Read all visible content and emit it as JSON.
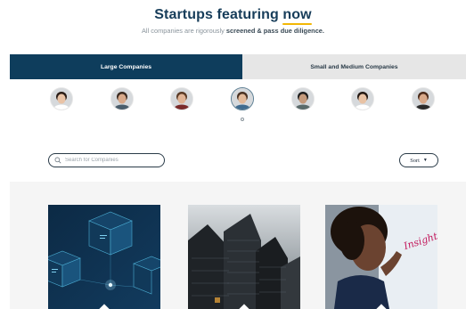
{
  "header": {
    "title_prefix": "Startups featuring ",
    "title_highlight": "now",
    "subtitle_prefix": "All companies are rigorously ",
    "subtitle_bold": "screened & pass due diligence."
  },
  "tabs": [
    {
      "label": "Large Companies",
      "active": true
    },
    {
      "label": "Small and Medium Companies",
      "active": false
    }
  ],
  "avatars": [
    {
      "name": "founder-avatar-1",
      "skin": "#e9c3a6",
      "hair": "#2b1d16",
      "shirt": "#ffffff"
    },
    {
      "name": "founder-avatar-2",
      "skin": "#d8a98a",
      "hair": "#3b2a20",
      "shirt": "#4a5d6b"
    },
    {
      "name": "founder-avatar-3",
      "skin": "#e0b496",
      "hair": "#5a3a25",
      "shirt": "#7a2a2a"
    },
    {
      "name": "founder-avatar-4",
      "skin": "#e2b999",
      "hair": "#4a3122",
      "shirt": "#3f6b8f"
    },
    {
      "name": "founder-avatar-5",
      "skin": "#c49a7c",
      "hair": "#1e1e1e",
      "shirt": "#5a6a6a"
    },
    {
      "name": "founder-avatar-6",
      "skin": "#e8c2a4",
      "hair": "#231812",
      "shirt": "#ffffff"
    },
    {
      "name": "founder-avatar-7",
      "skin": "#d8a98a",
      "hair": "#4a2a1a",
      "shirt": "#2a2a2a"
    }
  ],
  "search": {
    "placeholder": "Search for Companies",
    "value": ""
  },
  "sort": {
    "label": "Sort",
    "caret": "▼"
  },
  "cards": [
    {
      "name": "blockchain-cubes-image"
    },
    {
      "name": "skyscrapers-image"
    },
    {
      "name": "woman-whiteboard-image",
      "caption": "Insight"
    }
  ],
  "colors": {
    "navy": "#0e3d5c",
    "accent_yellow": "#f2b705",
    "tab_inactive": "#e6e6e6"
  },
  "icons": {
    "search": "search-icon",
    "sort_caret": "caret-down-icon"
  }
}
